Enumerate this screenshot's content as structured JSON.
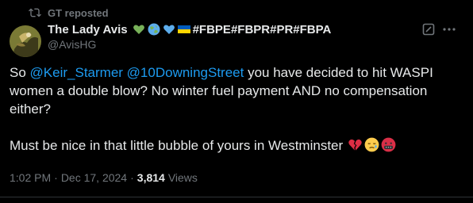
{
  "repost": {
    "icon": "repost-icon",
    "label": "GT reposted"
  },
  "author": {
    "avatar_icon": "avatar",
    "name": "The Lady Avis",
    "name_emojis": [
      "green-heart-emoji",
      "globe-emoji",
      "blue-heart-emoji",
      "ukraine-flag-emoji"
    ],
    "hashtags": "#FBPE#FBPR#PR#FBPA",
    "handle": "@AvisHG"
  },
  "actions": {
    "grok_icon": "grok-icon",
    "more_icon": "more-icon"
  },
  "tweet": {
    "line1_prefix": "So ",
    "mention1": "@Keir_Starmer",
    "space": " ",
    "mention2": "@10DowningStreet",
    "line1_suffix": " you have decided to hit WASPI women a double blow? No winter fuel payment AND no compensation either?",
    "line2": "Must be nice in that little bubble of yours in Westminster",
    "line2_emojis": [
      "broken-heart-emoji",
      "sad-relieved-face-emoji",
      "face-with-symbols-emoji"
    ]
  },
  "meta": {
    "time": "1:02 PM",
    "separator": "·",
    "date": "Dec 17, 2024",
    "views_count": "3,814",
    "views_label": "Views"
  },
  "colors": {
    "background": "#000000",
    "text": "#e7e9ea",
    "muted": "#71767b",
    "link": "#1d9bf0",
    "divider": "#2f3336"
  }
}
